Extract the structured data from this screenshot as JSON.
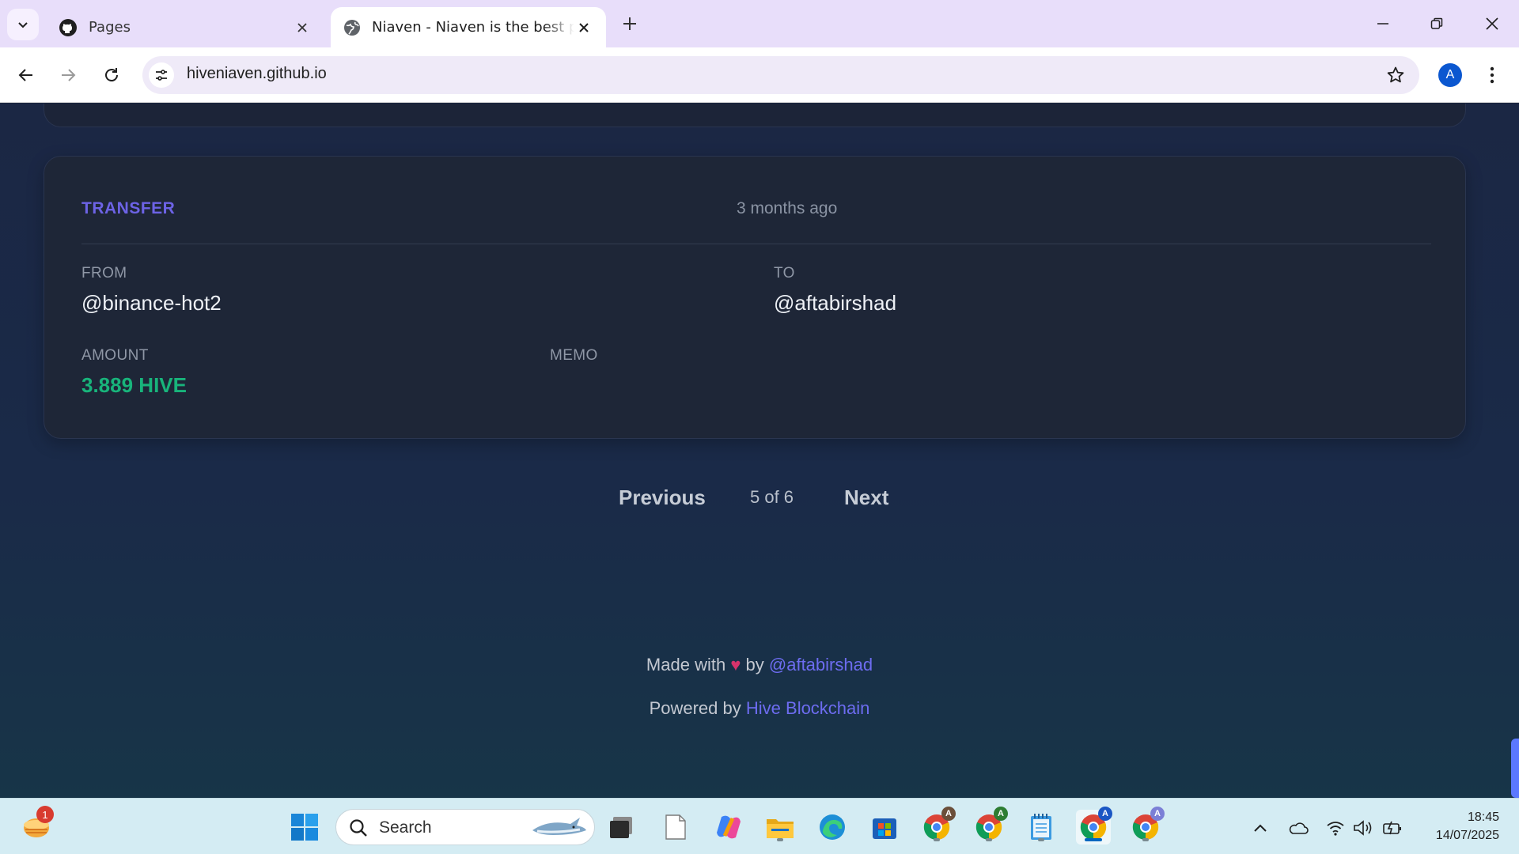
{
  "browser": {
    "tabs": [
      {
        "title": "Pages",
        "icon": "github-icon"
      },
      {
        "title": "Niaven - Niaven is the best platform",
        "icon": "globe-icon",
        "active": true
      }
    ],
    "url": "hiveniaven.github.io",
    "profile_initial": "A"
  },
  "operation": {
    "type": "TRANSFER",
    "time": "3 months ago",
    "from_label": "FROM",
    "from": "@binance-hot2",
    "to_label": "TO",
    "to": "@aftabirshad",
    "amount_label": "AMOUNT",
    "amount": "3.889 HIVE",
    "memo_label": "MEMO",
    "memo": ""
  },
  "pagination": {
    "previous": "Previous",
    "info": "5 of 6",
    "next": "Next"
  },
  "footer": {
    "made_with": "Made with",
    "heart": "♥",
    "by": "by",
    "author": "@aftabirshad",
    "powered_by": "Powered by",
    "platform": "Hive Blockchain"
  },
  "taskbar": {
    "search_label": "Search",
    "notification_count": "1",
    "chrome_profiles": [
      "A",
      "A",
      "A",
      "A"
    ],
    "time": "18:45",
    "date": "14/07/2025"
  },
  "colors": {
    "accent": "#6d63e6",
    "amount": "#18b47b",
    "link": "#6d6cf0"
  }
}
